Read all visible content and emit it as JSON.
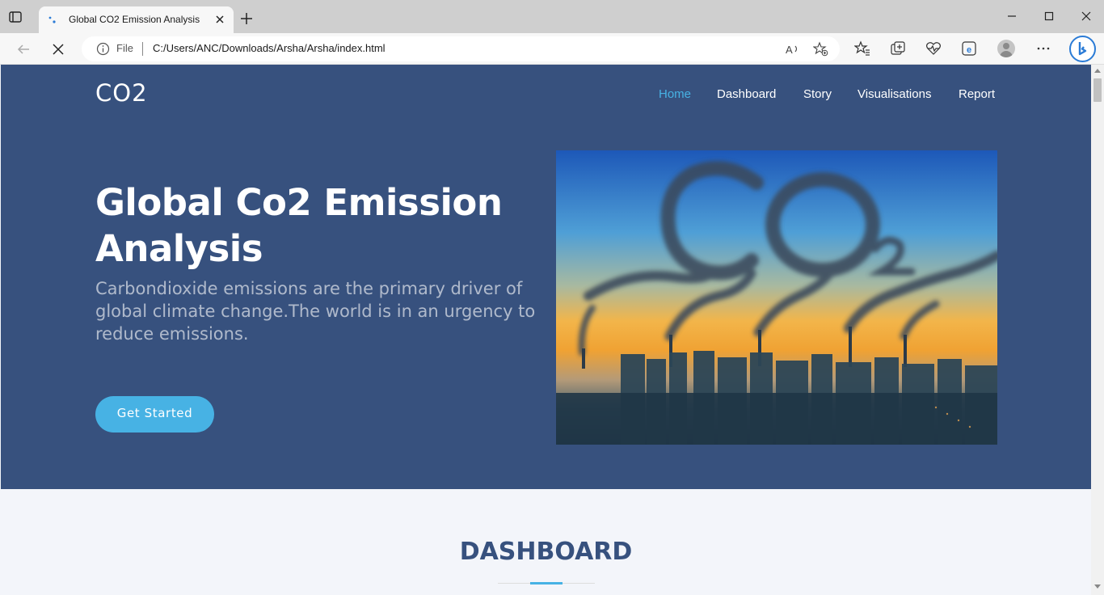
{
  "browser": {
    "tab_title": "Global CO2 Emission Analysis",
    "address_file": "File",
    "address_url": "C:/Users/ANC/Downloads/Arsha/Arsha/index.html"
  },
  "site": {
    "logo": "CO2",
    "nav": [
      "Home",
      "Dashboard",
      "Story",
      "Visualisations",
      "Report"
    ]
  },
  "hero": {
    "title": "Global Co2 Emission Analysis",
    "subtitle": "Carbondioxide emissions are the primary driver of global climate change.The world is in an urgency to reduce emissions.",
    "cta": "Get Started",
    "image_text": "CO2"
  },
  "section": {
    "title": "DASHBOARD"
  },
  "colors": {
    "hero_bg": "#37517e",
    "accent": "#47b2e4",
    "page_bg": "#f3f5fa"
  }
}
